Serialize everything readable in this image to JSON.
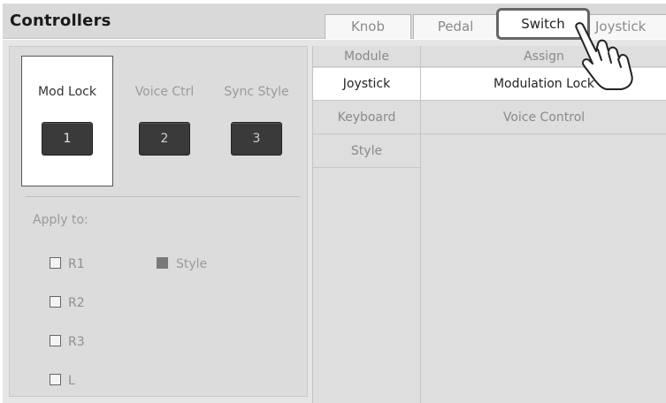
{
  "header": {
    "title": "Controllers",
    "tabs": [
      {
        "label": "Knob",
        "active": false
      },
      {
        "label": "Pedal",
        "active": false
      },
      {
        "label": "Switch",
        "active": true
      },
      {
        "label": "Joystick",
        "active": false
      }
    ]
  },
  "left_panel": {
    "switches": [
      {
        "label": "Mod Lock",
        "button": "1",
        "selected": true
      },
      {
        "label": "Voice Ctrl",
        "button": "2",
        "selected": false
      },
      {
        "label": "Sync Style",
        "button": "3",
        "selected": false
      }
    ],
    "apply_label": "Apply to:",
    "checkboxes": [
      {
        "label": "R1",
        "checked": false
      },
      {
        "label": "R2",
        "checked": false
      },
      {
        "label": "R3",
        "checked": false
      },
      {
        "label": "L",
        "checked": false
      }
    ],
    "style_option": {
      "label": "Style",
      "checked": true
    }
  },
  "table": {
    "headers": {
      "module": "Module",
      "assign": "Assign"
    },
    "rows": [
      {
        "module": "Joystick",
        "assign": "Modulation Lock",
        "selected": true
      },
      {
        "module": "Keyboard",
        "assign": "Voice Control",
        "selected": false
      },
      {
        "module": "Style",
        "assign": "",
        "selected": false
      }
    ]
  },
  "icons": {
    "pointer": "hand-pointer-icon"
  },
  "colors": {
    "header_bg": "#d9d9d9",
    "panel_bg": "#dcdcdc",
    "button_dark": "#3a3a3a",
    "active_tab_border": "#666666"
  }
}
